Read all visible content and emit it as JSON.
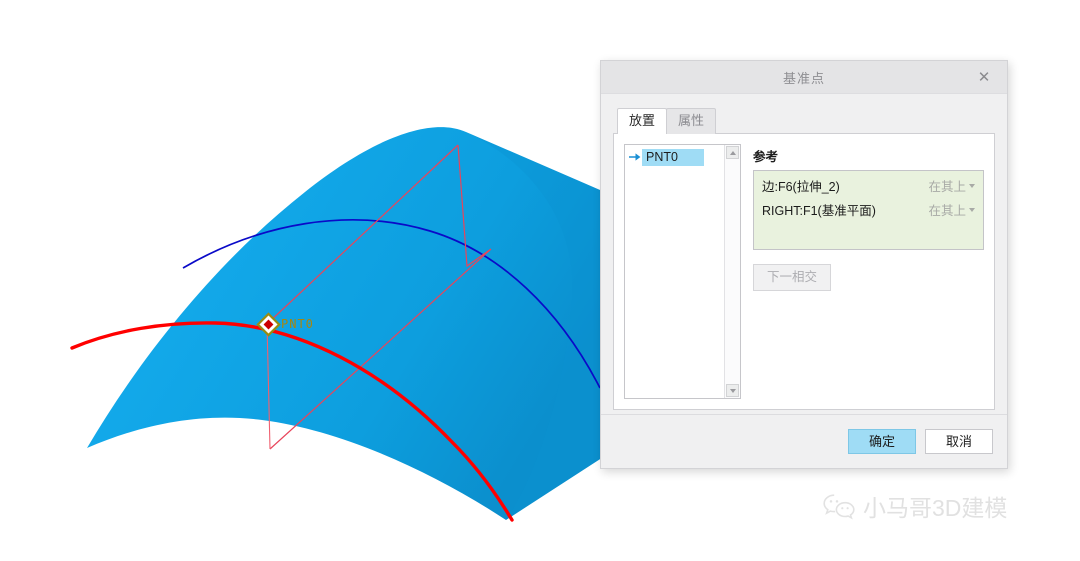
{
  "app": {
    "viewport_background": "#ffffff",
    "surface_color": "#14a7e8",
    "highlight_edge_color": "#ff0000",
    "isoline_color": "#0000cc",
    "datum_plane_line_color": "#e8444a",
    "point_label_color": "#a8860d"
  },
  "model": {
    "point_marker_name": "PNT0",
    "point_label": "PNT0",
    "marker_outline_color": "#b8a400",
    "marker_center_color": "#cc0000"
  },
  "watermark": {
    "icon": "wechat-icon",
    "text": "小马哥3D建模",
    "color": "#c9c9c9"
  },
  "dialog": {
    "title": "基准点",
    "close_label": "✕",
    "tabs": [
      {
        "label": "放置",
        "active": true
      },
      {
        "label": "属性",
        "active": false
      }
    ],
    "list": {
      "items": [
        {
          "label": "PNT0",
          "selected": true,
          "icon": "arrow-right-icon"
        }
      ],
      "scroll_up_icon": "chevron-up-icon",
      "scroll_down_icon": "chevron-down-icon"
    },
    "references": {
      "title": "参考",
      "rows": [
        {
          "name": "边:F6(拉伸_2)",
          "mode": "在其上"
        },
        {
          "name": "RIGHT:F1(基准平面)",
          "mode": "在其上"
        }
      ],
      "next_button": "下一相交"
    },
    "footer": {
      "ok_label": "确定",
      "cancel_label": "取消"
    }
  }
}
